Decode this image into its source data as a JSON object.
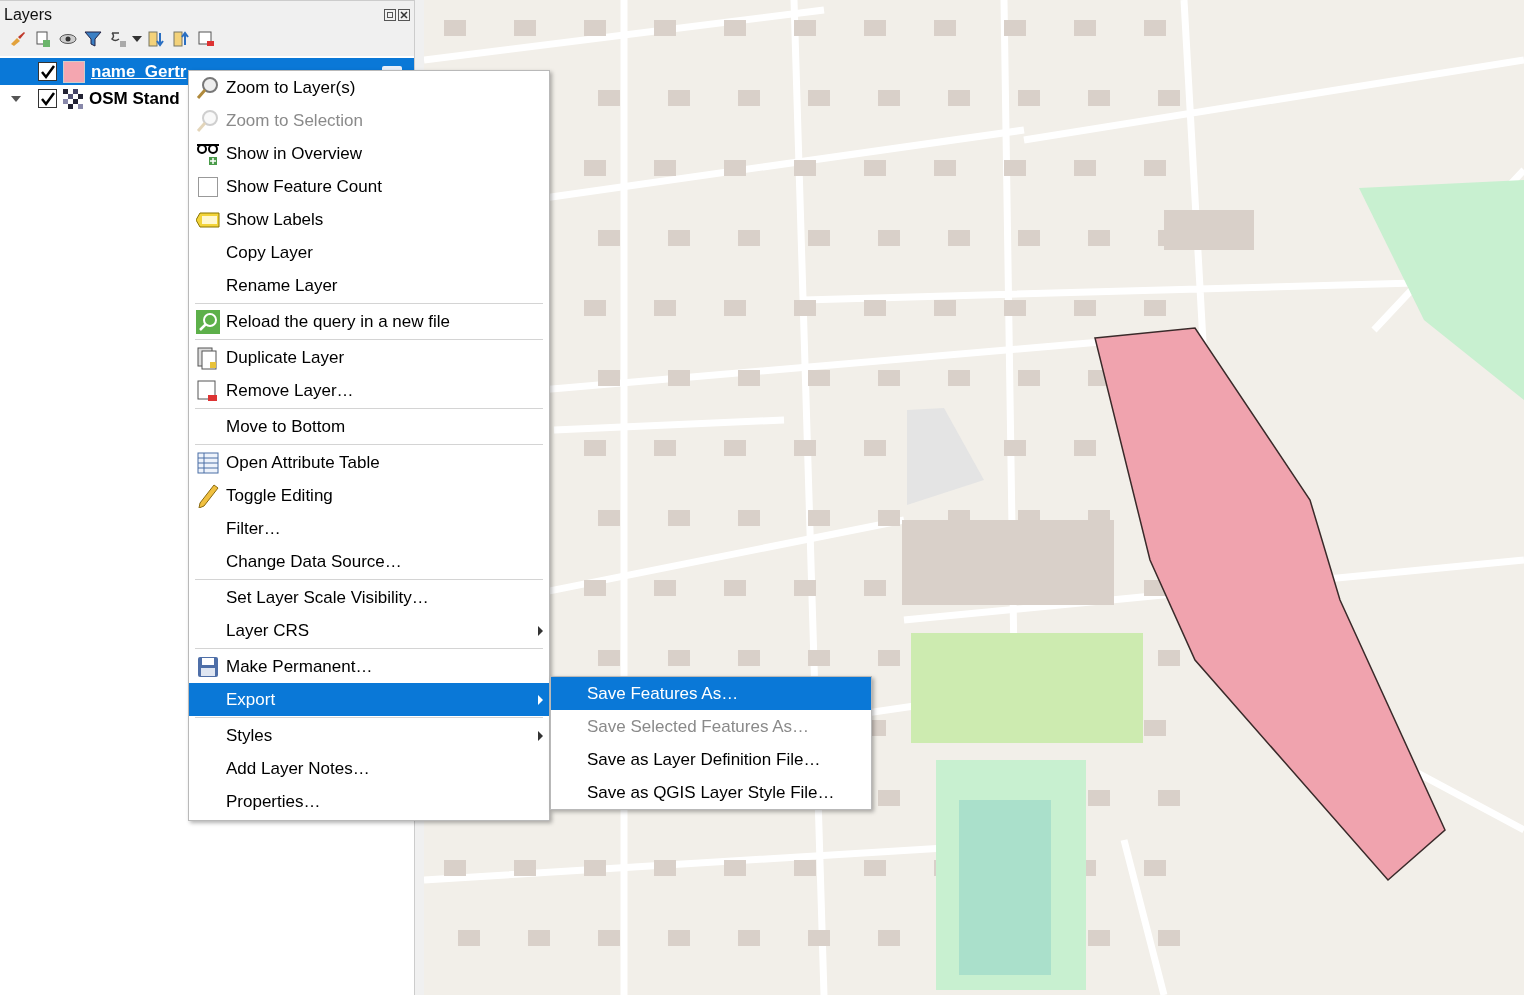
{
  "layers_panel": {
    "title": "Layers",
    "layers": [
      {
        "kind": "vector",
        "name": "name_Gertr",
        "checked": true,
        "selected": true,
        "color": "#f4a6b0"
      },
      {
        "kind": "raster",
        "name": "OSM Stand",
        "checked": true,
        "selected": false,
        "expanded": true
      }
    ]
  },
  "context_menu": {
    "items": [
      {
        "kind": "item",
        "label": "Zoom to Layer(s)",
        "disabled": false,
        "selected": false,
        "submenu": false
      },
      {
        "kind": "item",
        "label": "Zoom to Selection",
        "disabled": true,
        "selected": false,
        "submenu": false
      },
      {
        "kind": "item",
        "label": "Show in Overview",
        "disabled": false,
        "selected": false,
        "submenu": false
      },
      {
        "kind": "check",
        "label": "Show Feature Count",
        "checked": false,
        "disabled": false,
        "selected": false,
        "submenu": false
      },
      {
        "kind": "item",
        "label": "Show Labels",
        "disabled": false,
        "selected": false,
        "submenu": false
      },
      {
        "kind": "item",
        "label": "Copy Layer",
        "disabled": false,
        "selected": false,
        "submenu": false
      },
      {
        "kind": "item",
        "label": "Rename Layer",
        "disabled": false,
        "selected": false,
        "submenu": false
      },
      {
        "kind": "separator"
      },
      {
        "kind": "item",
        "label": "Reload the query in a new file",
        "disabled": false,
        "selected": false,
        "submenu": false
      },
      {
        "kind": "separator"
      },
      {
        "kind": "item",
        "label": "Duplicate Layer",
        "disabled": false,
        "selected": false,
        "submenu": false
      },
      {
        "kind": "item",
        "label": "Remove Layer…",
        "disabled": false,
        "selected": false,
        "submenu": false
      },
      {
        "kind": "separator"
      },
      {
        "kind": "item",
        "label": "Move to Bottom",
        "disabled": false,
        "selected": false,
        "submenu": false
      },
      {
        "kind": "separator"
      },
      {
        "kind": "item",
        "label": "Open Attribute Table",
        "disabled": false,
        "selected": false,
        "submenu": false
      },
      {
        "kind": "item",
        "label": "Toggle Editing",
        "disabled": false,
        "selected": false,
        "submenu": false
      },
      {
        "kind": "item",
        "label": "Filter…",
        "disabled": false,
        "selected": false,
        "submenu": false
      },
      {
        "kind": "item",
        "label": "Change Data Source…",
        "disabled": false,
        "selected": false,
        "submenu": false
      },
      {
        "kind": "separator"
      },
      {
        "kind": "item",
        "label": "Set Layer Scale Visibility…",
        "disabled": false,
        "selected": false,
        "submenu": false
      },
      {
        "kind": "item",
        "label": "Layer CRS",
        "disabled": false,
        "selected": false,
        "submenu": true
      },
      {
        "kind": "separator"
      },
      {
        "kind": "item",
        "label": "Make Permanent…",
        "disabled": false,
        "selected": false,
        "submenu": false
      },
      {
        "kind": "item",
        "label": "Export",
        "disabled": false,
        "selected": true,
        "submenu": true
      },
      {
        "kind": "separator"
      },
      {
        "kind": "item",
        "label": "Styles",
        "disabled": false,
        "selected": false,
        "submenu": true
      },
      {
        "kind": "item",
        "label": "Add Layer Notes…",
        "disabled": false,
        "selected": false,
        "submenu": false
      },
      {
        "kind": "item",
        "label": "Properties…",
        "disabled": false,
        "selected": false,
        "submenu": false
      }
    ]
  },
  "export_submenu": {
    "items": [
      {
        "label": "Save Features As…",
        "disabled": false,
        "selected": true
      },
      {
        "label": "Save Selected Features As…",
        "disabled": true,
        "selected": false
      },
      {
        "label": "Save as Layer Definition File…",
        "disabled": false,
        "selected": false
      },
      {
        "label": "Save as QGIS Layer Style File…",
        "disabled": false,
        "selected": false
      }
    ]
  }
}
